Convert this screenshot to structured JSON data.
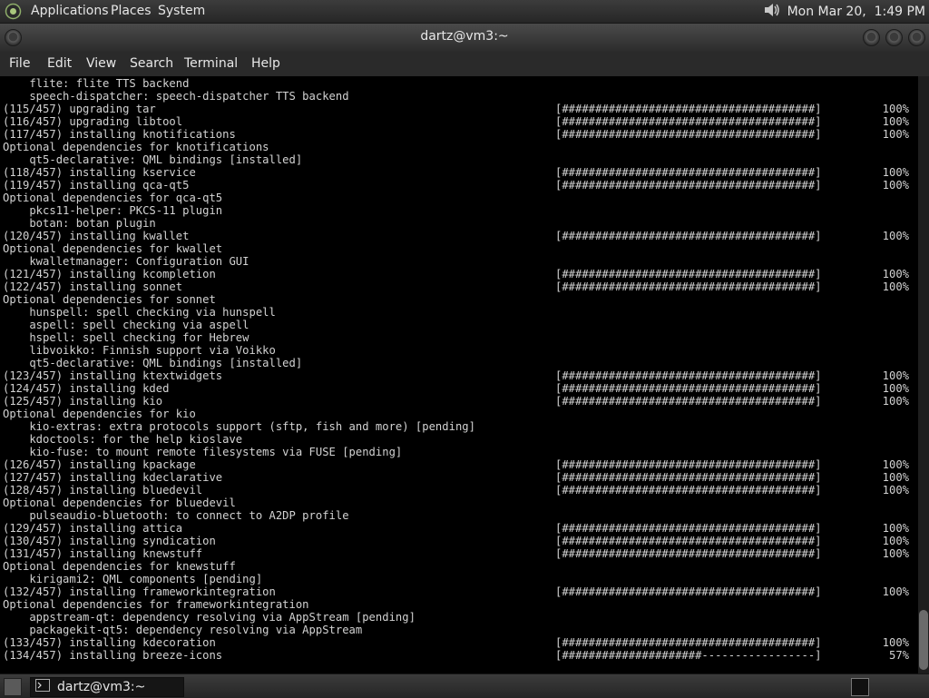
{
  "top_panel": {
    "applications": "Applications",
    "places": "Places",
    "system": "System",
    "clock": "Mon Mar 20,  1:49 PM",
    "volume_icon": "speaker-icon"
  },
  "window": {
    "title": "dartz@vm3:~"
  },
  "menubar": {
    "file": "File",
    "edit": "Edit",
    "view": "View",
    "search": "Search",
    "terminal": "Terminal",
    "help": "Help"
  },
  "terminal": {
    "lines": [
      {
        "text": "    flite: flite TTS backend"
      },
      {
        "text": "    speech-dispatcher: speech-dispatcher TTS backend"
      },
      {
        "text": "(115/457) upgrading tar",
        "bar": "[######################################]",
        "pct": "100%"
      },
      {
        "text": "(116/457) upgrading libtool",
        "bar": "[######################################]",
        "pct": "100%"
      },
      {
        "text": "(117/457) installing knotifications",
        "bar": "[######################################]",
        "pct": "100%"
      },
      {
        "text": "Optional dependencies for knotifications"
      },
      {
        "text": "    qt5-declarative: QML bindings [installed]"
      },
      {
        "text": "(118/457) installing kservice",
        "bar": "[######################################]",
        "pct": "100%"
      },
      {
        "text": "(119/457) installing qca-qt5",
        "bar": "[######################################]",
        "pct": "100%"
      },
      {
        "text": "Optional dependencies for qca-qt5"
      },
      {
        "text": "    pkcs11-helper: PKCS-11 plugin"
      },
      {
        "text": "    botan: botan plugin"
      },
      {
        "text": "(120/457) installing kwallet",
        "bar": "[######################################]",
        "pct": "100%"
      },
      {
        "text": "Optional dependencies for kwallet"
      },
      {
        "text": "    kwalletmanager: Configuration GUI"
      },
      {
        "text": "(121/457) installing kcompletion",
        "bar": "[######################################]",
        "pct": "100%"
      },
      {
        "text": "(122/457) installing sonnet",
        "bar": "[######################################]",
        "pct": "100%"
      },
      {
        "text": "Optional dependencies for sonnet"
      },
      {
        "text": "    hunspell: spell checking via hunspell"
      },
      {
        "text": "    aspell: spell checking via aspell"
      },
      {
        "text": "    hspell: spell checking for Hebrew"
      },
      {
        "text": "    libvoikko: Finnish support via Voikko"
      },
      {
        "text": "    qt5-declarative: QML bindings [installed]"
      },
      {
        "text": "(123/457) installing ktextwidgets",
        "bar": "[######################################]",
        "pct": "100%"
      },
      {
        "text": "(124/457) installing kded",
        "bar": "[######################################]",
        "pct": "100%"
      },
      {
        "text": "(125/457) installing kio",
        "bar": "[######################################]",
        "pct": "100%"
      },
      {
        "text": "Optional dependencies for kio"
      },
      {
        "text": "    kio-extras: extra protocols support (sftp, fish and more) [pending]"
      },
      {
        "text": "    kdoctools: for the help kioslave"
      },
      {
        "text": "    kio-fuse: to mount remote filesystems via FUSE [pending]"
      },
      {
        "text": "(126/457) installing kpackage",
        "bar": "[######################################]",
        "pct": "100%"
      },
      {
        "text": "(127/457) installing kdeclarative",
        "bar": "[######################################]",
        "pct": "100%"
      },
      {
        "text": "(128/457) installing bluedevil",
        "bar": "[######################################]",
        "pct": "100%"
      },
      {
        "text": "Optional dependencies for bluedevil"
      },
      {
        "text": "    pulseaudio-bluetooth: to connect to A2DP profile"
      },
      {
        "text": "(129/457) installing attica",
        "bar": "[######################################]",
        "pct": "100%"
      },
      {
        "text": "(130/457) installing syndication",
        "bar": "[######################################]",
        "pct": "100%"
      },
      {
        "text": "(131/457) installing knewstuff",
        "bar": "[######################################]",
        "pct": "100%"
      },
      {
        "text": "Optional dependencies for knewstuff"
      },
      {
        "text": "    kirigami2: QML components [pending]"
      },
      {
        "text": "(132/457) installing frameworkintegration",
        "bar": "[######################################]",
        "pct": "100%"
      },
      {
        "text": "Optional dependencies for frameworkintegration"
      },
      {
        "text": "    appstream-qt: dependency resolving via AppStream [pending]"
      },
      {
        "text": "    packagekit-qt5: dependency resolving via AppStream"
      },
      {
        "text": "(133/457) installing kdecoration",
        "bar": "[######################################]",
        "pct": "100%"
      },
      {
        "text": "(134/457) installing breeze-icons",
        "bar": "[#####################-----------------]",
        "pct": "57%"
      }
    ]
  },
  "taskbar": {
    "item_label": "dartz@vm3:~"
  },
  "colors": {
    "terminal_bg": "#000000",
    "terminal_fg": "#d2d2d2",
    "panel_bg": "#2b2b2b"
  }
}
